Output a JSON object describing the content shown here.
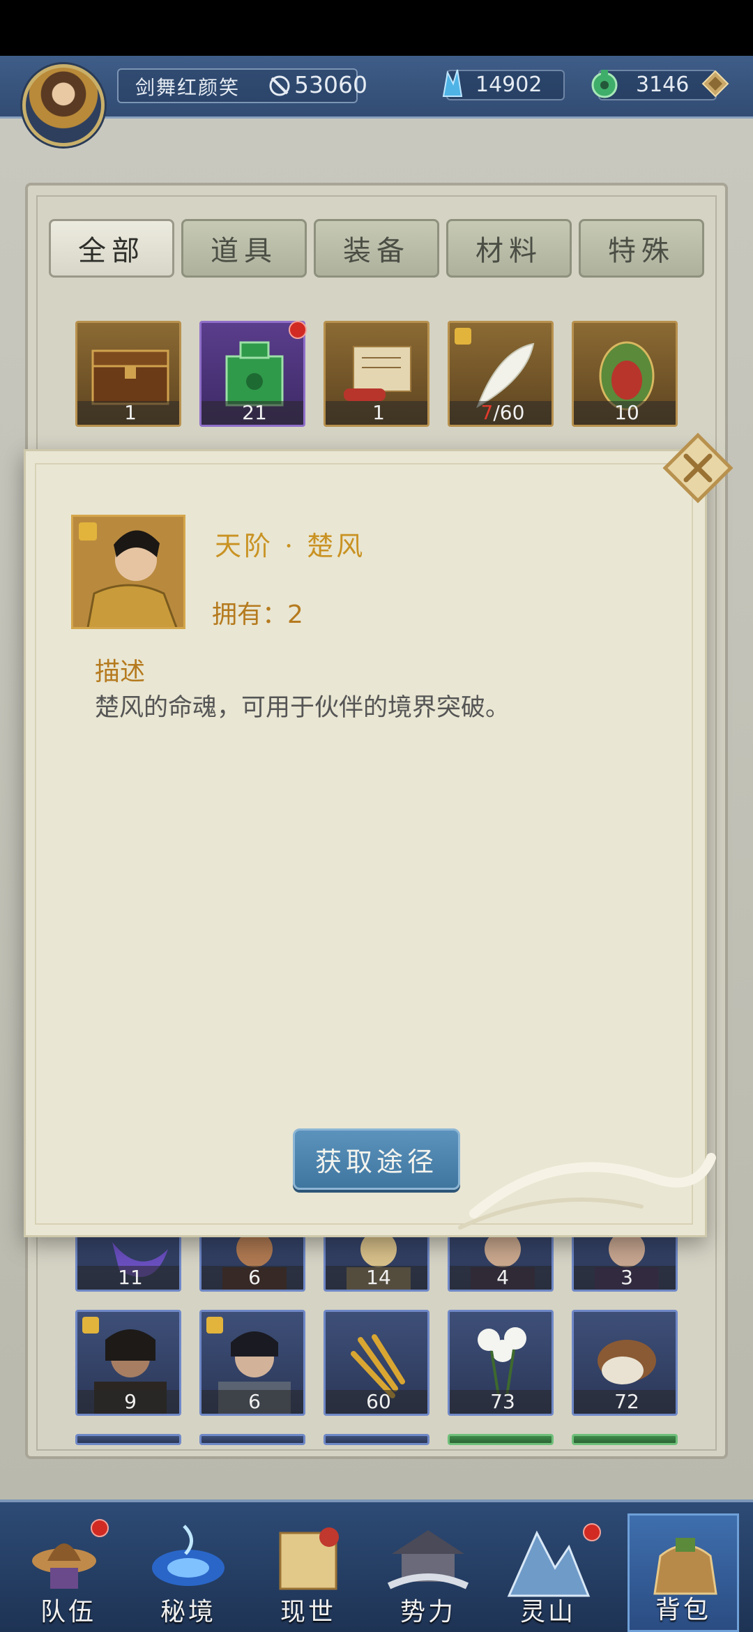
{
  "player": {
    "name": "剑舞红颜笑",
    "power": "53060"
  },
  "resources": {
    "crystal": "14902",
    "jade": "3146"
  },
  "tabs": [
    "全部",
    "道具",
    "装备",
    "材料",
    "特殊"
  ],
  "row1_counts": [
    "1",
    "21",
    "1",
    "60",
    "10"
  ],
  "row1_fragment_have": "7",
  "row1_fragment_total": "/60",
  "row_partial_counts": [
    "11",
    "6",
    "14",
    "4",
    "3"
  ],
  "row3_counts": [
    "9",
    "6",
    "60",
    "73",
    "72"
  ],
  "popup": {
    "title": "天阶 · 楚风",
    "owned": "拥有：2",
    "desc_heading": "描述",
    "desc_text": "楚风的命魂，可用于伙伴的境界突破。",
    "button": "获取途径"
  },
  "nav": [
    "队伍",
    "秘境",
    "现世",
    "势力",
    "灵山",
    "背包"
  ],
  "icons": {
    "power": "sword-shield-icon",
    "crystal": "crystal-icon",
    "jade": "jade-coin-icon",
    "add": "diamond-add-icon",
    "close": "close-icon"
  },
  "colors": {
    "title_gold": "#c99222",
    "accent_blue": "#3f769f",
    "badge_red": "#d12a22"
  }
}
